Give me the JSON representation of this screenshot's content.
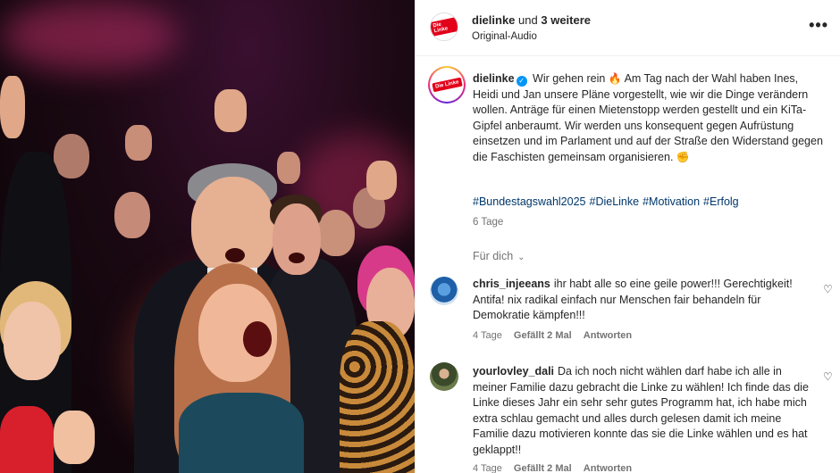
{
  "header": {
    "username": "dielinke",
    "connector": "und",
    "others": "3 weitere",
    "audio": "Original-Audio",
    "more_label": "•••"
  },
  "post": {
    "username": "dielinke",
    "verified_icon": "verified-badge-icon",
    "caption_part1": "Wir gehen rein",
    "fire_emoji": "🔥",
    "caption_part2": "Am Tag nach der Wahl haben Ines, Heidi und Jan unsere Pläne vorgestellt, wie wir die Dinge verändern wollen. Anträge für einen Mietenstopp werden gestellt und ein KiTa-Gipfel anberaumt. Wir werden uns konsequent gegen Aufrüstung einsetzen und im Parlament und auf der Straße den Widerstand gegen die Faschisten gemeinsam organisieren.",
    "fist_emoji": "✊",
    "hashtags": [
      "#Bundestagswahl2025",
      "#DieLinke",
      "#Motivation",
      "#Erfolg"
    ],
    "time": "6 Tage",
    "logo_text": "Die Linke"
  },
  "comments_filter": {
    "label": "Für dich",
    "icon": "chevron-down-icon"
  },
  "comments": [
    {
      "username": "chris_injeeans",
      "text": "ihr habt alle so eine geile power!!! Gerechtigkeit! Antifa! nix radikal einfach nur Menschen fair behandeln für Demokratie kämpfen!!!",
      "time": "4 Tage",
      "likes": "Gefällt 2 Mal",
      "reply": "Antworten"
    },
    {
      "username": "yourlovley_dali",
      "text": "Da ich noch nicht wählen darf habe ich alle in meiner Familie dazu gebracht die Linke zu wählen! Ich finde das die Linke dieses Jahr ein sehr sehr gutes Programm hat, ich habe mich extra schlau gemacht und alles durch gelesen damit ich meine Familie dazu motivieren konnte das sie die Linke wählen und es hat geklappt!!",
      "time": "4 Tage",
      "likes": "Gefällt 2 Mal",
      "reply": "Antworten"
    }
  ],
  "colors": {
    "link": "#00376b",
    "muted": "#737373",
    "brand_red": "#e2001a",
    "verified": "#0095f6"
  }
}
